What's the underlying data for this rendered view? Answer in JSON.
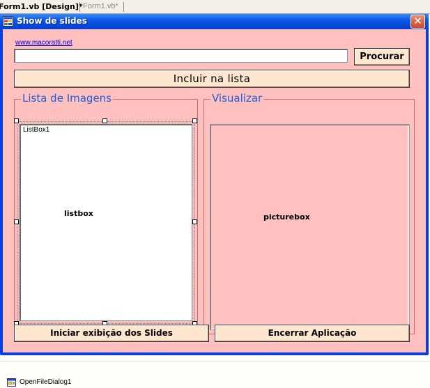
{
  "tabs": [
    {
      "label": "Form1.vb [Design]*",
      "active": true
    },
    {
      "label": "Form1.vb*",
      "active": false
    }
  ],
  "form": {
    "title": "Show de slides",
    "link_text": "www.macoratti.net",
    "path_value": "",
    "procurar_label": "Procurar",
    "incluir_label": "Incluir na lista",
    "lista_group_title": "Lista de Imagens",
    "visualizar_group_title": "Visualizar",
    "listbox_item": "ListBox1",
    "listbox_caption": "listbox",
    "picturebox_caption": "picturebox",
    "iniciar_label": "Iniciar  exibição dos Slides",
    "encerrar_label": "Encerrar Aplicação"
  },
  "component_tray": {
    "items": [
      {
        "label": "OpenFileDialog1",
        "icon": "open-file-dialog-icon"
      }
    ]
  },
  "colors": {
    "form_background": "#ffc0c0",
    "group_title": "#1f5fd6",
    "button_face": "#ffe7cf",
    "titlebar": "#0a59e6"
  }
}
